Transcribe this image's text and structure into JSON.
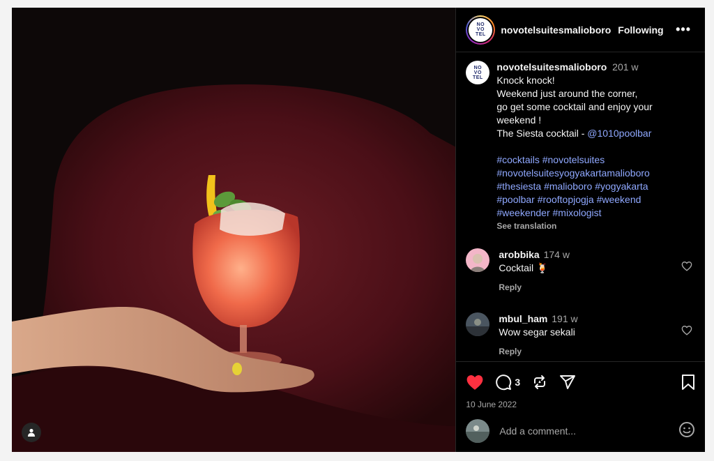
{
  "post": {
    "username": "novotelsuitesmalioboro",
    "follow_label": "Following",
    "more_label": "•••",
    "logo_lines": [
      "NO",
      "VO",
      "TEL"
    ],
    "logo_sub": "SUITES",
    "caption": {
      "username": "novotelsuitesmalioboro",
      "time": "201 w",
      "lines": [
        "Knock knock!",
        "Weekend just around the corner,",
        "go get some cocktail and enjoy your",
        "weekend !"
      ],
      "credit_prefix": "The Siesta cocktail - ",
      "credit_mention": "@1010poolbar",
      "hashtag_lines": [
        "#cocktails #novotelsuites",
        "#novotelsuitesyogyakartamalioboro",
        "#thesiesta #malioboro #yogyakarta",
        "#poolbar #rooftopjogja #weekend",
        "#weekender #mixologist"
      ],
      "see_translation": "See translation"
    },
    "comments": [
      {
        "username": "arobbika",
        "time": "174 w",
        "text": "Cocktail 🍹",
        "reply": "Reply"
      },
      {
        "username": "mbul_ham",
        "time": "191 w",
        "text": "Wow segar sekali",
        "reply": "Reply"
      }
    ],
    "comment_count": "3",
    "date": "10 June 2022",
    "add_comment_placeholder": "Add a comment...",
    "liked": true,
    "colors": {
      "like": "#ff3040",
      "link": "#8fa8ff",
      "muted": "#a8a8a8"
    }
  }
}
